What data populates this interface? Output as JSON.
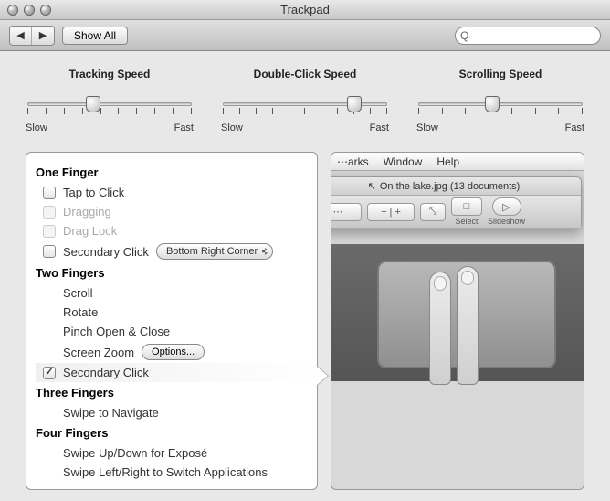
{
  "window": {
    "title": "Trackpad"
  },
  "toolbar": {
    "back_icon": "◀",
    "fwd_icon": "▶",
    "show_all": "Show All",
    "search_placeholder": "",
    "search_value": "",
    "search_glyph": "Q"
  },
  "sliders": {
    "tracking": {
      "title": "Tracking Speed",
      "low": "Slow",
      "high": "Fast",
      "value_pct": 40
    },
    "double": {
      "title": "Double-Click Speed",
      "low": "Slow",
      "high": "Fast",
      "value_pct": 80
    },
    "scroll": {
      "title": "Scrolling Speed",
      "low": "Slow",
      "high": "Fast",
      "value_pct": 45
    }
  },
  "options": {
    "one_finger": {
      "head": "One Finger",
      "tap_to_click": {
        "label": "Tap to Click",
        "checked": false,
        "enabled": true
      },
      "dragging": {
        "label": "Dragging",
        "checked": false,
        "enabled": false
      },
      "drag_lock": {
        "label": "Drag Lock",
        "checked": false,
        "enabled": false
      },
      "secondary": {
        "label": "Secondary Click",
        "checked": false,
        "enabled": true,
        "popup": "Bottom Right Corner"
      }
    },
    "two_fingers": {
      "head": "Two Fingers",
      "scroll": {
        "label": "Scroll"
      },
      "rotate": {
        "label": "Rotate"
      },
      "pinch": {
        "label": "Pinch Open & Close"
      },
      "zoom": {
        "label": "Screen Zoom",
        "options_btn": "Options..."
      },
      "secondary": {
        "label": "Secondary Click",
        "checked": true,
        "selected": true
      }
    },
    "three_fingers": {
      "head": "Three Fingers",
      "swipe_nav": {
        "label": "Swipe to Navigate"
      }
    },
    "four_fingers": {
      "head": "Four Fingers",
      "swipe_expose": {
        "label": "Swipe Up/Down for Exposé"
      },
      "swipe_apps": {
        "label": "Swipe Left/Right to Switch Applications"
      }
    }
  },
  "preview": {
    "menubar": {
      "item1": "⋯arks",
      "item2": "Window",
      "item3": "Help"
    },
    "win_title": "On the lake.jpg (13 documents)",
    "tools": {
      "prevnext": {
        "label": "⋯",
        "sub": ""
      },
      "zoom": {
        "label": "− | +",
        "sub": ""
      },
      "move": {
        "label": "⤡",
        "sub": ""
      },
      "select": {
        "label": "□",
        "sub": "Select"
      },
      "slideshow": {
        "label": "▷",
        "sub": "Slideshow"
      }
    }
  }
}
